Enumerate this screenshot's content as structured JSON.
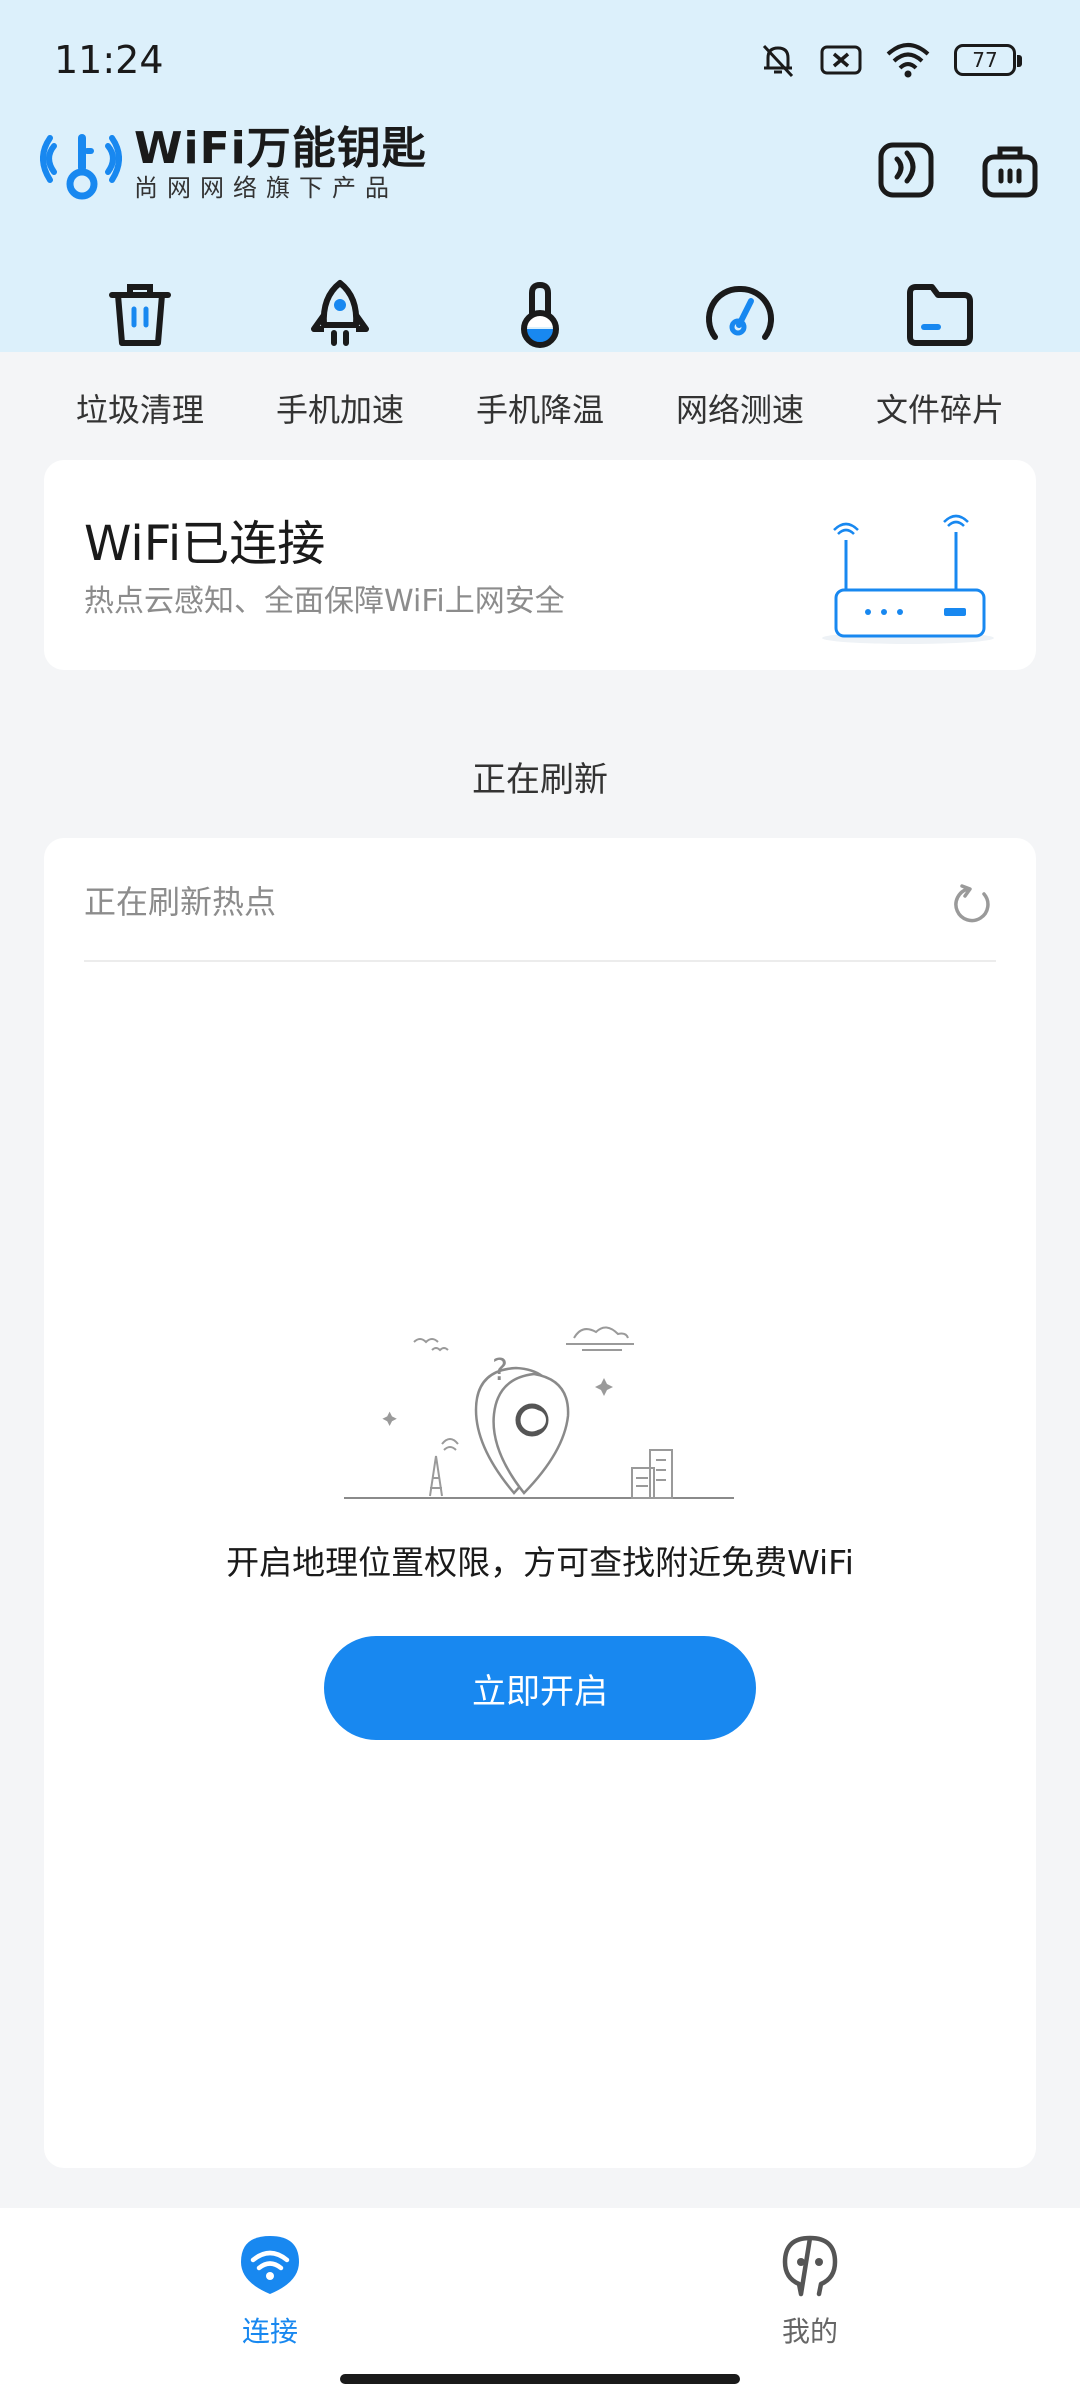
{
  "status_bar": {
    "time": "11:24",
    "battery": "77"
  },
  "header": {
    "app_name": "WiFi万能钥匙",
    "subtitle": "尚网网络旗下产品"
  },
  "tools": [
    {
      "label": "垃圾清理",
      "icon": "trash-icon"
    },
    {
      "label": "手机加速",
      "icon": "rocket-icon"
    },
    {
      "label": "手机降温",
      "icon": "thermometer-icon"
    },
    {
      "label": "网络测速",
      "icon": "speedometer-icon"
    },
    {
      "label": "文件碎片",
      "icon": "folder-icon"
    }
  ],
  "wifi_card": {
    "title": "WiFi已连接",
    "subtitle": "热点云感知、全面保障WiFi上网安全"
  },
  "refresh": {
    "heading": "正在刷新",
    "row_label": "正在刷新热点"
  },
  "empty_state": {
    "message": "开启地理位置权限，方可查找附近免费WiFi",
    "button_label": "立即开启"
  },
  "bottom_nav": [
    {
      "label": "连接",
      "icon": "wifi-tab-icon",
      "active": true
    },
    {
      "label": "我的",
      "icon": "profile-tab-icon",
      "active": false
    }
  ],
  "colors": {
    "accent": "#1888f0",
    "header_bg": "#dcf0fb",
    "page_bg": "#f4f5f7",
    "inactive_nav": "#666666"
  }
}
